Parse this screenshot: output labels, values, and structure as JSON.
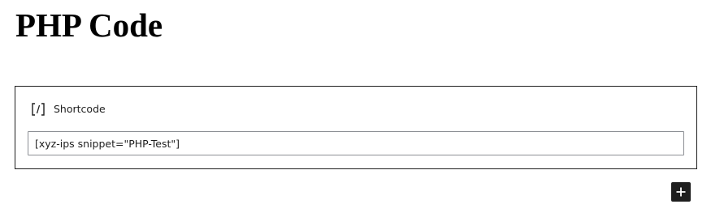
{
  "page": {
    "title": "PHP Code"
  },
  "shortcode_block": {
    "icon": "shortcode-bracket-icon",
    "label": "Shortcode",
    "value": "[xyz-ips snippet=\"PHP-Test\"]"
  },
  "inserter": {
    "icon": "plus-icon"
  },
  "colors": {
    "text": "#1e1e1e",
    "block_border": "#1e1e1e",
    "input_border": "#8c8f94",
    "inserter_bg": "#1e1e1e",
    "inserter_fg": "#ffffff"
  }
}
